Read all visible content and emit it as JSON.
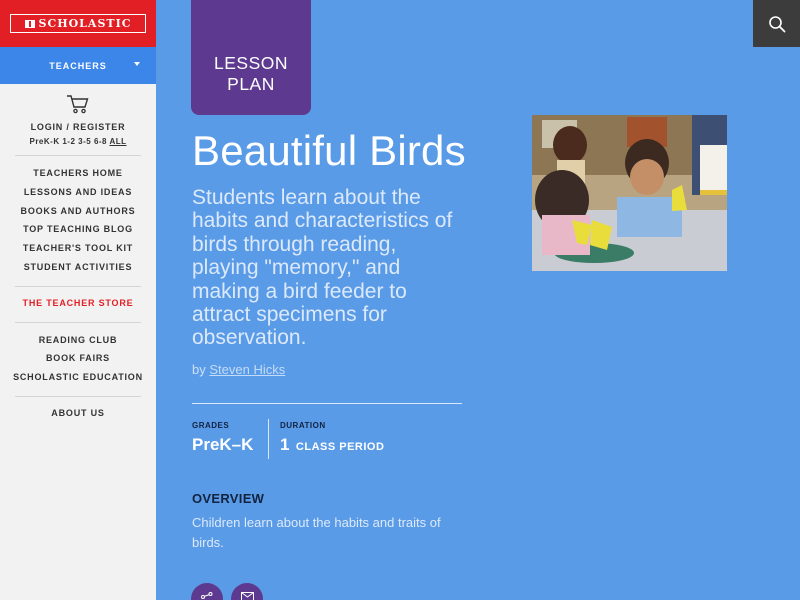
{
  "brand": {
    "name": "SCHOLASTIC",
    "color": "#e31f26"
  },
  "role_menu": {
    "label": "TEACHERS"
  },
  "account": {
    "login_label": "LOGIN / REGISTER",
    "grade_links": [
      "PreK-K",
      "1-2",
      "3-5",
      "6-8",
      "ALL"
    ]
  },
  "nav_group_1": [
    "TEACHERS HOME",
    "LESSONS AND IDEAS",
    "BOOKS AND AUTHORS",
    "TOP TEACHING BLOG",
    "TEACHER'S TOOL KIT",
    "STUDENT ACTIVITIES"
  ],
  "store": {
    "label": "THE TEACHER STORE"
  },
  "nav_group_2": [
    "READING CLUB",
    "BOOK FAIRS",
    "SCHOLASTIC EDUCATION"
  ],
  "nav_group_3": [
    "ABOUT US"
  ],
  "badge": {
    "line1": "LESSON",
    "line2": "PLAN"
  },
  "lesson": {
    "title": "Beautiful Birds",
    "summary": "Students learn about the habits and characteristics of birds through reading, playing \"memory,\" and making a bird feeder to attract specimens for observation.",
    "by": "by",
    "author": "Steven Hicks"
  },
  "meta": {
    "grades_label": "GRADES",
    "grades_value": "PreK–K",
    "duration_label": "DURATION",
    "duration_number": "1",
    "duration_unit": "CLASS PERIOD"
  },
  "overview": {
    "heading": "OVERVIEW",
    "text": "Children learn about the habits and traits of birds."
  },
  "icons": {
    "search": "search-icon",
    "cart": "cart-icon",
    "share": "share-icon",
    "email": "email-icon"
  },
  "colors": {
    "background": "#5a9be8",
    "accent": "#5d3a8f",
    "sidebar": "#f2f2f2",
    "role_bar": "#3c86ea"
  }
}
